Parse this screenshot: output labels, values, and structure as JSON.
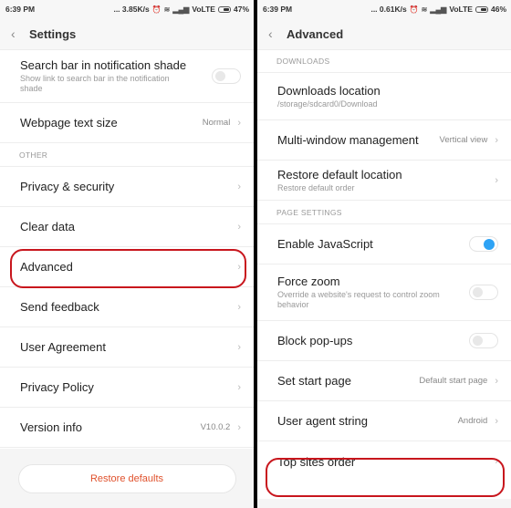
{
  "left": {
    "status": {
      "time": "6:39 PM",
      "speed": "... 3.85K/s",
      "network": "VoLTE",
      "battery": "47%"
    },
    "title": "Settings",
    "rows_top": [
      {
        "label": "Search bar in notification shade",
        "sub": "Show link to search bar in the notification shade",
        "toggle": false
      },
      {
        "label": "Webpage text size",
        "value": "Normal"
      }
    ],
    "section_other": "OTHER",
    "rows": [
      {
        "label": "Privacy & security"
      },
      {
        "label": "Clear data"
      },
      {
        "label": "Advanced"
      },
      {
        "label": "Send feedback"
      },
      {
        "label": "User Agreement"
      },
      {
        "label": "Privacy Policy"
      },
      {
        "label": "Version info",
        "value": "V10.0.2"
      }
    ],
    "restore_label": "Restore defaults"
  },
  "right": {
    "status": {
      "time": "6:39 PM",
      "speed": "... 0.61K/s",
      "network": "VoLTE",
      "battery": "46%"
    },
    "title": "Advanced",
    "section_downloads": "DOWNLOADS",
    "downloads_rows": [
      {
        "label": "Downloads location",
        "sub": "/storage/sdcard0/Download"
      },
      {
        "label": "Multi-window management",
        "value": "Vertical view"
      },
      {
        "label": "Restore default location",
        "sub": "Restore default order"
      }
    ],
    "section_page": "PAGE SETTINGS",
    "page_rows": [
      {
        "label": "Enable JavaScript",
        "toggle": true
      },
      {
        "label": "Force zoom",
        "sub": "Override a website's request to control zoom behavior",
        "toggle": false
      },
      {
        "label": "Block pop-ups",
        "toggle": false
      },
      {
        "label": "Set start page",
        "value": "Default start page"
      },
      {
        "label": "User agent string",
        "value": "Android"
      },
      {
        "label": "Top sites order"
      }
    ]
  },
  "icons": {
    "back": "‹",
    "chevron": "›"
  },
  "colors": {
    "accent": "#2ea3f5",
    "highlight": "#c8161d",
    "restore_text": "#e0522d"
  }
}
